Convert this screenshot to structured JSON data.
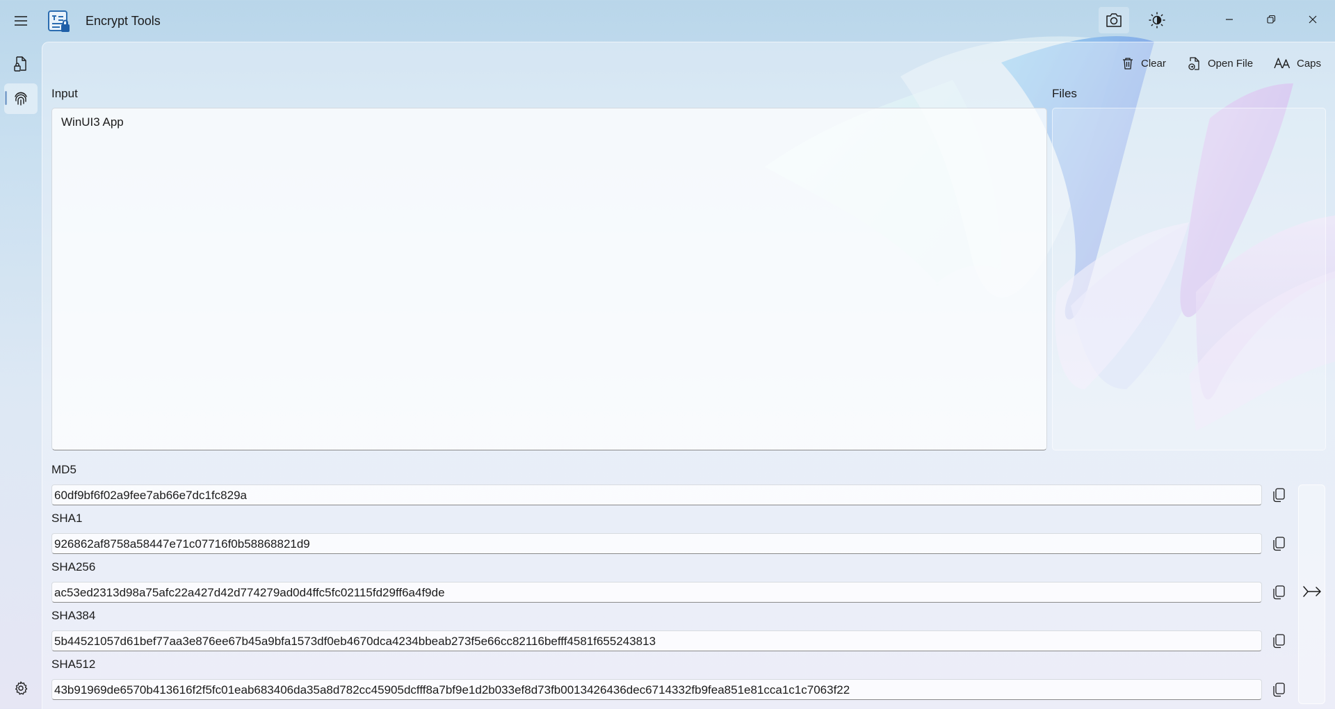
{
  "app": {
    "title": "Encrypt Tools"
  },
  "titlebar": {
    "icons": [
      "hamburger-icon",
      "app-logo-icon",
      "camera-icon",
      "brightness-icon",
      "minimize-icon",
      "restore-icon",
      "close-icon"
    ]
  },
  "nav": {
    "items": [
      {
        "icon": "file-lock-icon"
      },
      {
        "icon": "fingerprint-icon",
        "selected": true
      },
      {
        "icon": "gear-icon"
      }
    ]
  },
  "toolbar": {
    "clear_label": "Clear",
    "open_file_label": "Open File",
    "caps_label": "Caps"
  },
  "input": {
    "label": "Input",
    "value": "WinUI3 App"
  },
  "files": {
    "label": "Files"
  },
  "hashes": [
    {
      "label": "MD5",
      "value": "60df9bf6f02a9fee7ab66e7dc1fc829a"
    },
    {
      "label": "SHA1",
      "value": "926862af8758a58447e71c07716f0b58868821d9"
    },
    {
      "label": "SHA256",
      "value": "ac53ed2313d98a75afc22a427d42d774279ad0d4ffc5fc02115fd29ff6a4f9de"
    },
    {
      "label": "SHA384",
      "value": "5b44521057d61bef77aa3e876ee67b45a9bfa1573df0eb4670dca4234bbeab273f5e66cc82116befff4581f655243813"
    },
    {
      "label": "SHA512",
      "value": "43b91969de6570b413616f2f5fc01eab683406da35a8d782cc45905dcfff8a7bf9e1d2b033ef8d73fb0013426436dec6714332fb9fea851e81cca1c1c7063f22"
    }
  ],
  "colors": {
    "accent": "#1f5fa8",
    "background": "#c8dff0"
  }
}
